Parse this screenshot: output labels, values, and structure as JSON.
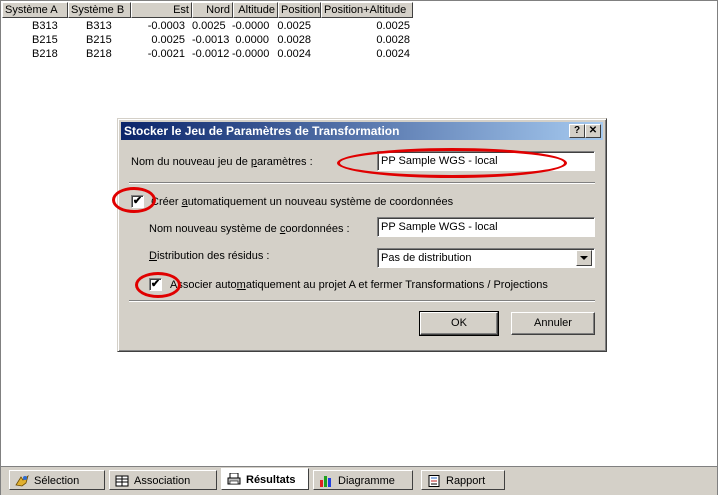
{
  "table": {
    "headers": [
      "Système A",
      "Système B",
      "Est",
      "Nord",
      "Altitude",
      "Position",
      "Position+Altitude"
    ],
    "rows": [
      [
        "B313",
        "B313",
        "-0.0003",
        "0.0025",
        "-0.0000",
        "0.0025",
        "0.0025"
      ],
      [
        "B215",
        "B215",
        "0.0025",
        "-0.0013",
        "0.0000",
        "0.0028",
        "0.0028"
      ],
      [
        "B218",
        "B218",
        "-0.0021",
        "-0.0012",
        "-0.0000",
        "0.0024",
        "0.0024"
      ]
    ]
  },
  "dialog": {
    "title": "Stocker le Jeu de Paramètres de Transformation",
    "help_label": "?",
    "close_label": "✕",
    "param_set_label_pre": "Nom du nouveau jeu de ",
    "param_set_label_u": "p",
    "param_set_label_post": "aramètres :",
    "param_set_value": "PP Sample WGS - local",
    "create_checked_mark": "✔",
    "create_label_pre": "Créer ",
    "create_label_u": "a",
    "create_label_post": "utomatiquement un nouveau système de coordonnées",
    "coord_name_label_pre": "Nom nouveau système de ",
    "coord_name_label_u": "c",
    "coord_name_label_post": "oordonnées :",
    "coord_name_value": "PP Sample WGS - local",
    "residual_label_u": "D",
    "residual_label_post": "istribution des résidus :",
    "residual_value": "Pas de distribution",
    "assoc_checked_mark": "✔",
    "assoc_label_pre": "Associer auto",
    "assoc_label_u": "m",
    "assoc_label_post": "atiquement au projet A et fermer Transformations / Projections",
    "ok_label": "OK",
    "cancel_label": "Annuler"
  },
  "tabs": [
    {
      "label": "Sélection",
      "icon": "selection-icon"
    },
    {
      "label": "Association",
      "icon": "association-icon"
    },
    {
      "label": "Résultats",
      "icon": "results-icon"
    },
    {
      "label": "Diagramme",
      "icon": "diagram-icon"
    },
    {
      "label": "Rapport",
      "icon": "report-icon"
    }
  ],
  "colors": {
    "annotation": "#e00000",
    "title_bar_start": "#0a246a",
    "title_bar_end": "#a6caf0"
  }
}
